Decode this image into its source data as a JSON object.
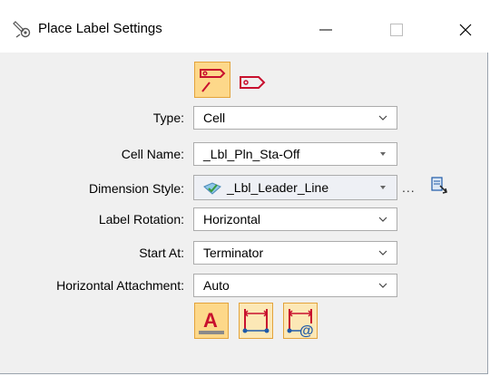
{
  "window": {
    "title": "Place Label Settings"
  },
  "titlebar": {
    "icons": [
      "settings-tools-icon",
      "minimize-icon",
      "maximize-icon",
      "close-icon"
    ]
  },
  "modes": {
    "active": "place-label-with-leader-icon",
    "items": [
      "place-label-with-leader-icon",
      "place-label-tag-icon"
    ]
  },
  "fields": [
    {
      "label": "Type:",
      "value": "Cell"
    },
    {
      "label": "Cell Name:",
      "value": "_Lbl_Pln_Sta-Off"
    },
    {
      "label": "Dimension Style:",
      "value": "_Lbl_Leader_Line"
    },
    {
      "label": "Label Rotation:",
      "value": "Horizontal"
    },
    {
      "label": "Start At:",
      "value": "Terminator"
    },
    {
      "label": "Horizontal Attachment:",
      "value": "Auto"
    }
  ],
  "dimension_style_more": "...",
  "bottom_buttons": [
    "text-label-icon",
    "dimension-icon",
    "dimension-at-icon"
  ],
  "colors": {
    "active_button": "#fdd88a",
    "active_border": "#e3a33b",
    "icon_red": "#c8102e",
    "icon_blue": "#1e5aa8"
  }
}
